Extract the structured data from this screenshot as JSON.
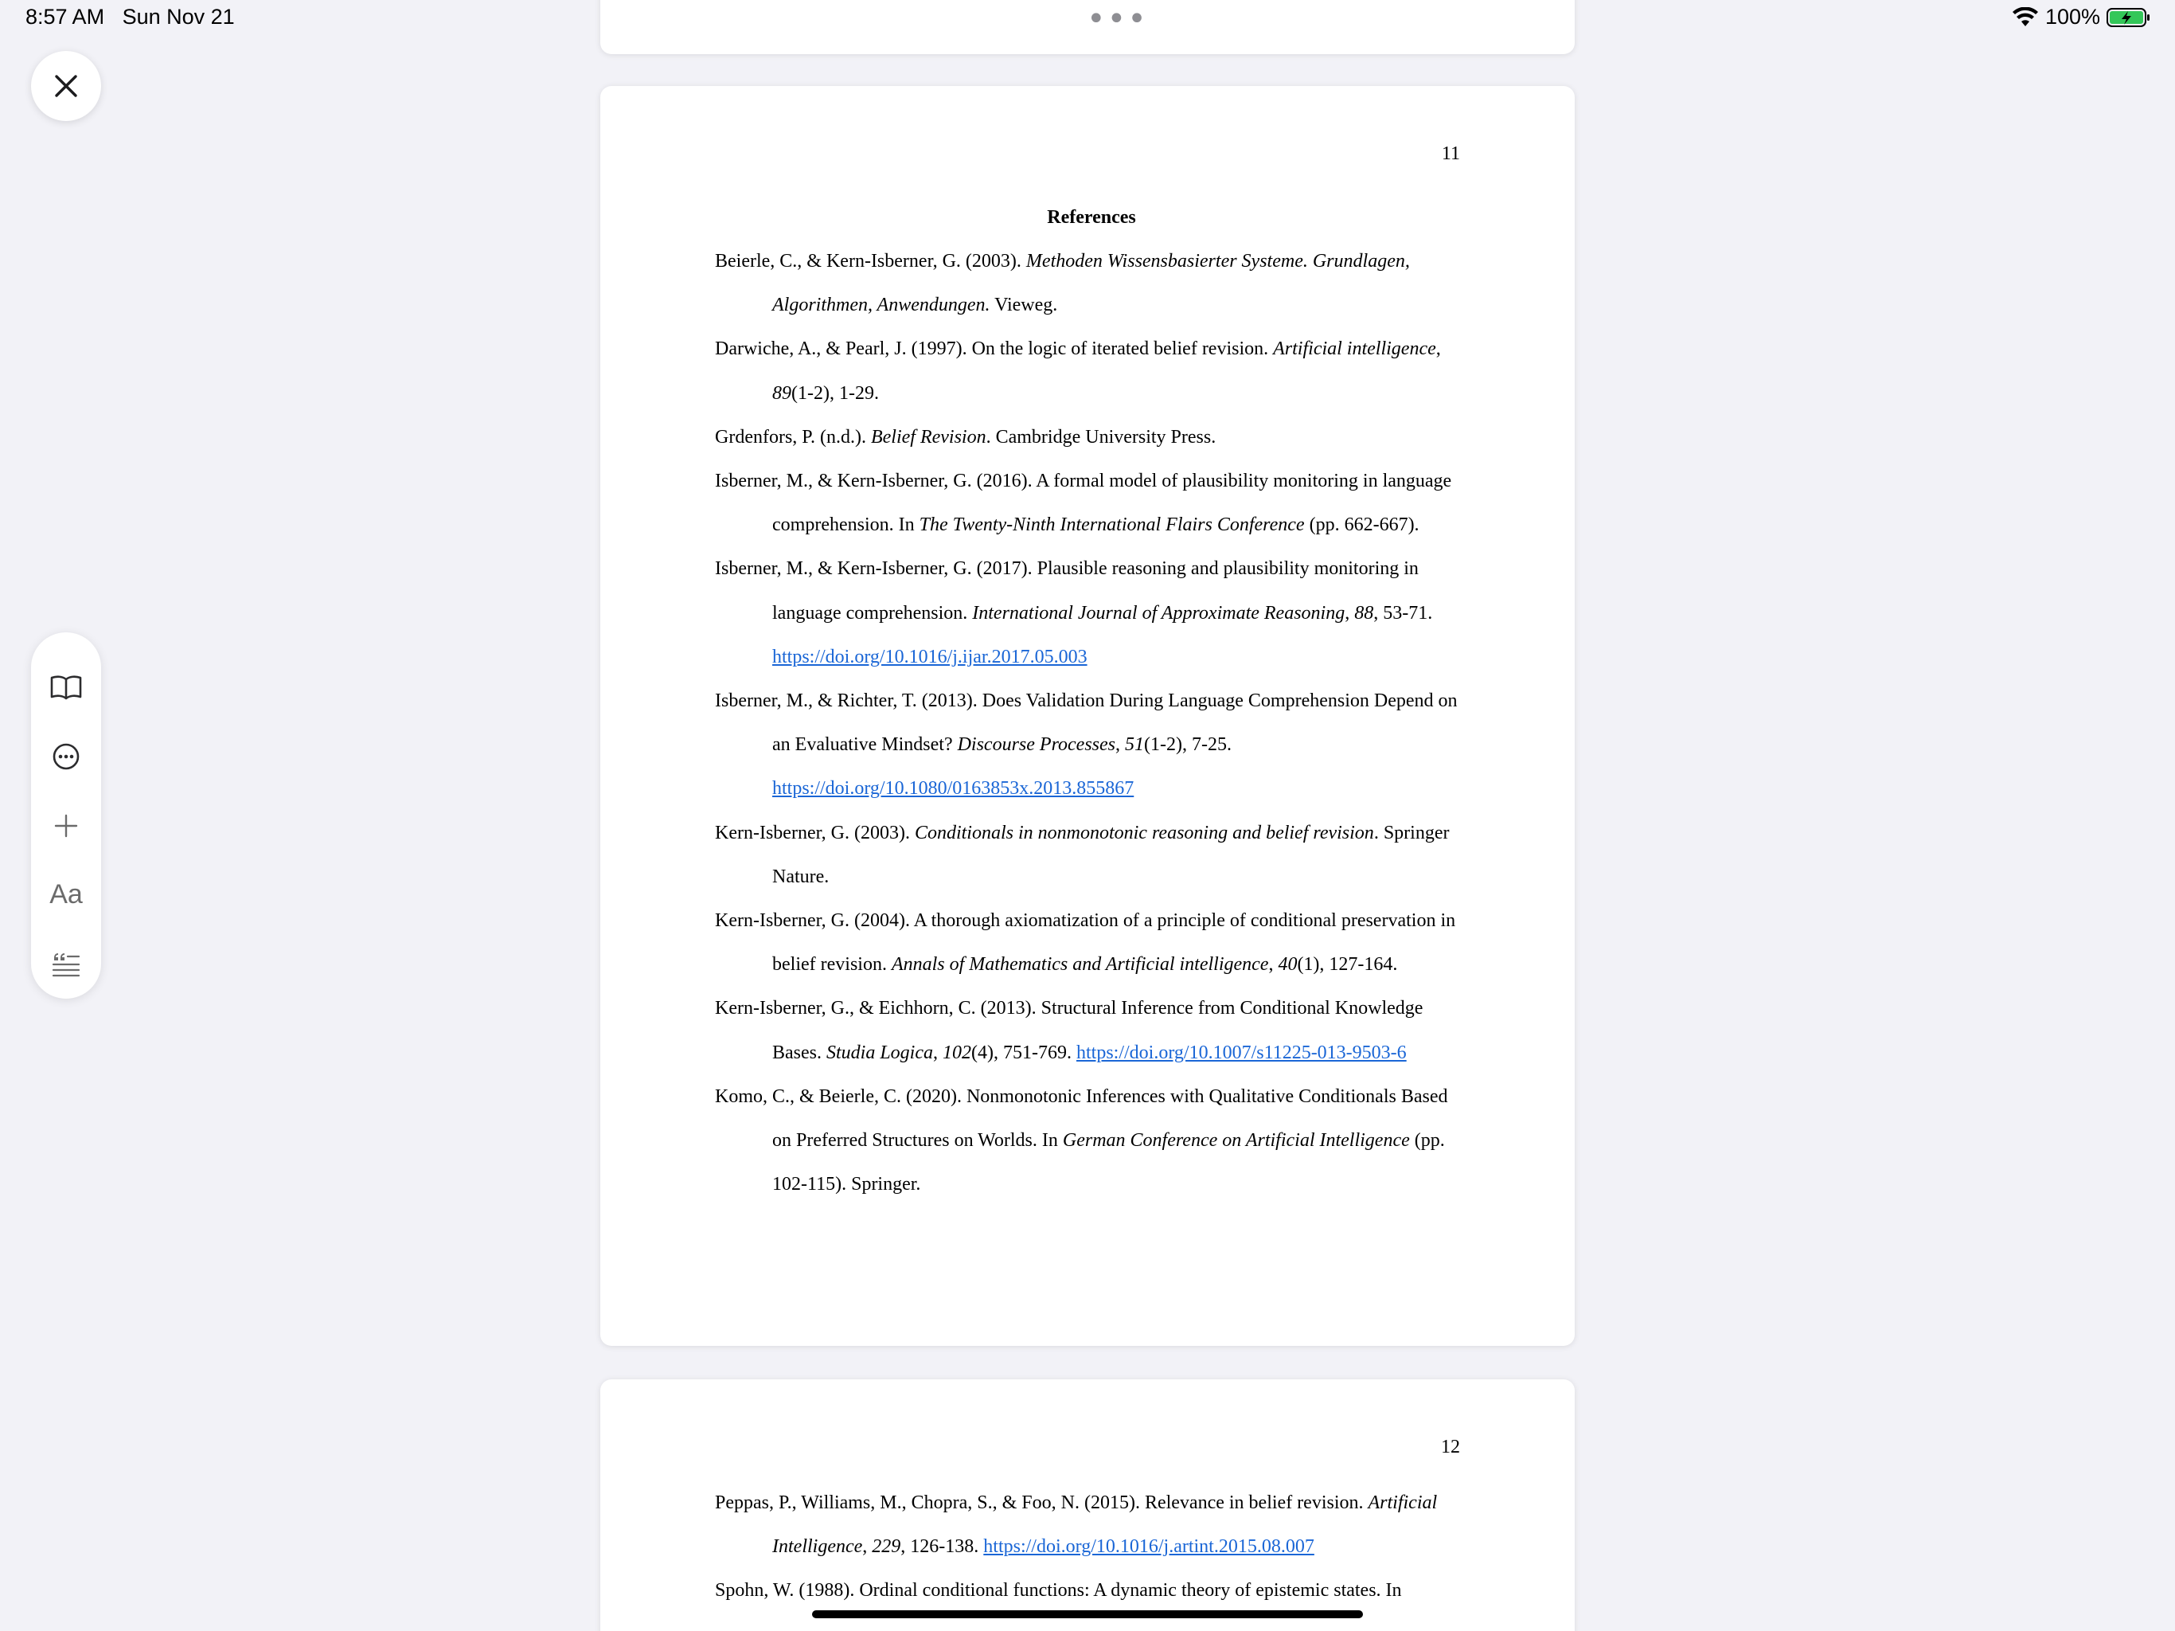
{
  "status_bar": {
    "time": "8:57 AM",
    "date": "Sun Nov 21",
    "battery": "100%"
  },
  "top_menu": {
    "label": "•••"
  },
  "toolbar": {
    "font_label": "Aa",
    "icons": [
      "book-icon",
      "more-circle-icon",
      "plus-icon",
      "font-icon",
      "quote-list-icon"
    ]
  },
  "page_main": {
    "number": "11",
    "heading": "References",
    "references": [
      {
        "a": "Beierle, C., & Kern-Isberner, G. (2003). ",
        "i": "Methoden Wissensbasierter Systeme. Grundlagen, Algorithmen, Anwendungen.",
        "b": " Vieweg.",
        "link": ""
      },
      {
        "a": "Darwiche, A., & Pearl, J. (1997). On the logic of iterated belief revision. ",
        "i": "Artificial intelligence",
        "b": ", ",
        "i2": "89",
        "c": "(1-2), 1-29.",
        "link": ""
      },
      {
        "a": "Grdenfors, P. (n.d.). ",
        "i": "Belief Revision",
        "b": ". Cambridge University Press.",
        "link": ""
      },
      {
        "a": "Isberner, M., & Kern-Isberner, G. (2016). A formal model of plausibility monitoring in language comprehension. In ",
        "i": "The Twenty-Ninth International Flairs Conference",
        "b": " (pp. 662-667).",
        "link": ""
      },
      {
        "a": "Isberner, M., & Kern-Isberner, G. (2017). Plausible reasoning and plausibility monitoring in language comprehension. ",
        "i": "International Journal of Approximate Reasoning",
        "b": ", ",
        "i2": "88",
        "c": ", 53-71. ",
        "link": "https://doi.org/10.1016/j.ijar.2017.05.003"
      },
      {
        "a": "Isberner, M., & Richter, T. (2013). Does Validation During Language Comprehension Depend on an Evaluative Mindset? ",
        "i": "Discourse Processes",
        "b": ", ",
        "i2": "51",
        "c": "(1-2), 7-25. ",
        "link": "https://doi.org/10.1080/0163853x.2013.855867"
      },
      {
        "a": "Kern-Isberner, G. (2003). ",
        "i": "Conditionals in nonmonotonic reasoning and belief revision",
        "b": ". Springer Nature.",
        "link": ""
      },
      {
        "a": "Kern-Isberner, G. (2004). A thorough axiomatization of a principle of conditional preservation in belief revision. ",
        "i": "Annals of Mathematics and Artificial intelligence",
        "b": ", ",
        "i2": "40",
        "c": "(1), 127-164.",
        "link": ""
      },
      {
        "a": "Kern-Isberner, G., & Eichhorn, C. (2013). Structural Inference from Conditional Knowledge Bases. ",
        "i": "Studia Logica",
        "b": ", ",
        "i2": "102",
        "c": "(4), 751-769. ",
        "link": "https://doi.org/10.1007/s11225-013-9503-6"
      },
      {
        "a": "Komo, C., & Beierle, C. (2020). Nonmonotonic Inferences with Qualitative Conditionals Based on Preferred Structures on Worlds. In ",
        "i": "German Conference on Artificial Intelligence",
        "b": " (pp. 102-115). Springer.",
        "link": ""
      }
    ]
  },
  "page_next": {
    "number": "12",
    "references": [
      {
        "a": "Peppas, P., Williams, M., Chopra, S., & Foo, N. (2015). Relevance in belief revision. ",
        "i": "Artificial Intelligence",
        "b": ", ",
        "i2": "229",
        "c": ", 126-138. ",
        "link": "https://doi.org/10.1016/j.artint.2015.08.007"
      },
      {
        "a": "Spohn, W. (1988). Ordinal conditional functions: A dynamic theory of epistemic states. In",
        "i": "",
        "b": "",
        "link": ""
      }
    ]
  }
}
